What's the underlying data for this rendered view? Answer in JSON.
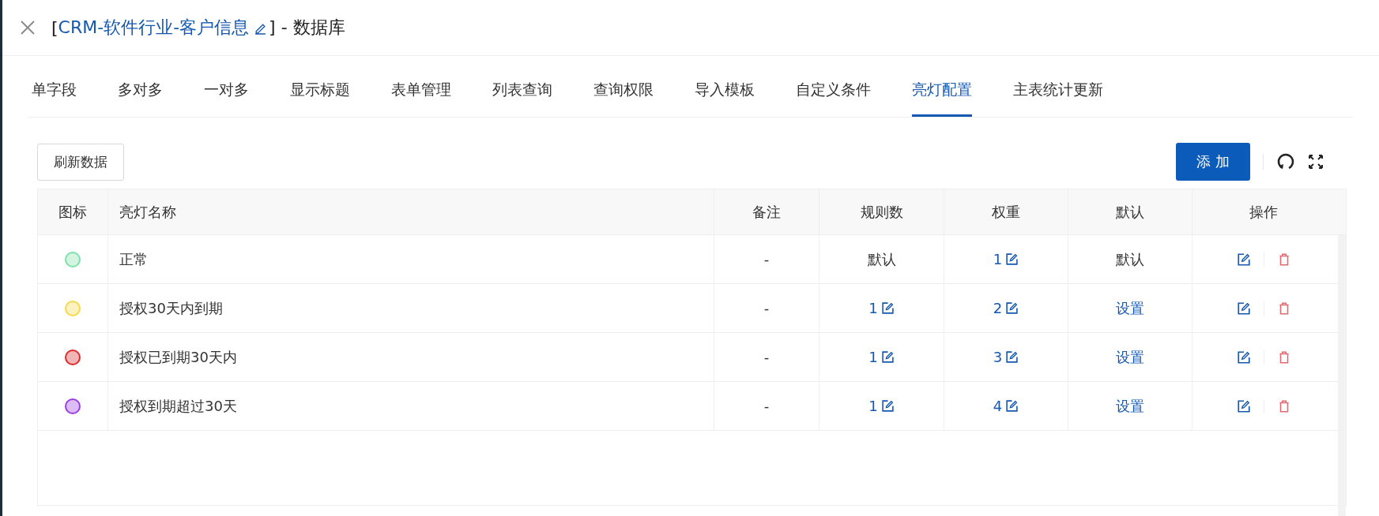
{
  "window": {
    "title_prefix": "[",
    "title_link": "CRM-软件行业-客户信息",
    "title_suffix": "] - 数据库"
  },
  "tabs": [
    {
      "label": "单字段",
      "selected": false
    },
    {
      "label": "多对多",
      "selected": false
    },
    {
      "label": "一对多",
      "selected": false
    },
    {
      "label": "显示标题",
      "selected": false
    },
    {
      "label": "表单管理",
      "selected": false
    },
    {
      "label": "列表查询",
      "selected": false
    },
    {
      "label": "查询权限",
      "selected": false
    },
    {
      "label": "导入模板",
      "selected": false
    },
    {
      "label": "自定义条件",
      "selected": false
    },
    {
      "label": "亮灯配置",
      "selected": true
    },
    {
      "label": "主表统计更新",
      "selected": false
    }
  ],
  "toolbar": {
    "refresh_button": "刷新数据",
    "add_button": "添 加"
  },
  "table": {
    "columns": [
      "图标",
      "亮灯名称",
      "备注",
      "规则数",
      "权重",
      "默认",
      "操作"
    ],
    "rows": [
      {
        "color": "#7ee0a8",
        "name": "正常",
        "remark": "-",
        "rules": {
          "kind": "text",
          "text": "默认"
        },
        "weight": {
          "kind": "link",
          "text": "1"
        },
        "default": {
          "kind": "text",
          "text": "默认"
        }
      },
      {
        "color": "#f5d94a",
        "name": "授权30天内到期",
        "remark": "-",
        "rules": {
          "kind": "link",
          "text": "1"
        },
        "weight": {
          "kind": "link",
          "text": "2"
        },
        "default": {
          "kind": "action",
          "text": "设置"
        }
      },
      {
        "color": "#d92b2b",
        "name": "授权已到期30天内",
        "remark": "-",
        "rules": {
          "kind": "link",
          "text": "1"
        },
        "weight": {
          "kind": "link",
          "text": "3"
        },
        "default": {
          "kind": "action",
          "text": "设置"
        }
      },
      {
        "color": "#9a3fe0",
        "name": "授权到期超过30天",
        "remark": "-",
        "rules": {
          "kind": "link",
          "text": "1"
        },
        "weight": {
          "kind": "link",
          "text": "4"
        },
        "default": {
          "kind": "action",
          "text": "设置"
        }
      }
    ]
  }
}
